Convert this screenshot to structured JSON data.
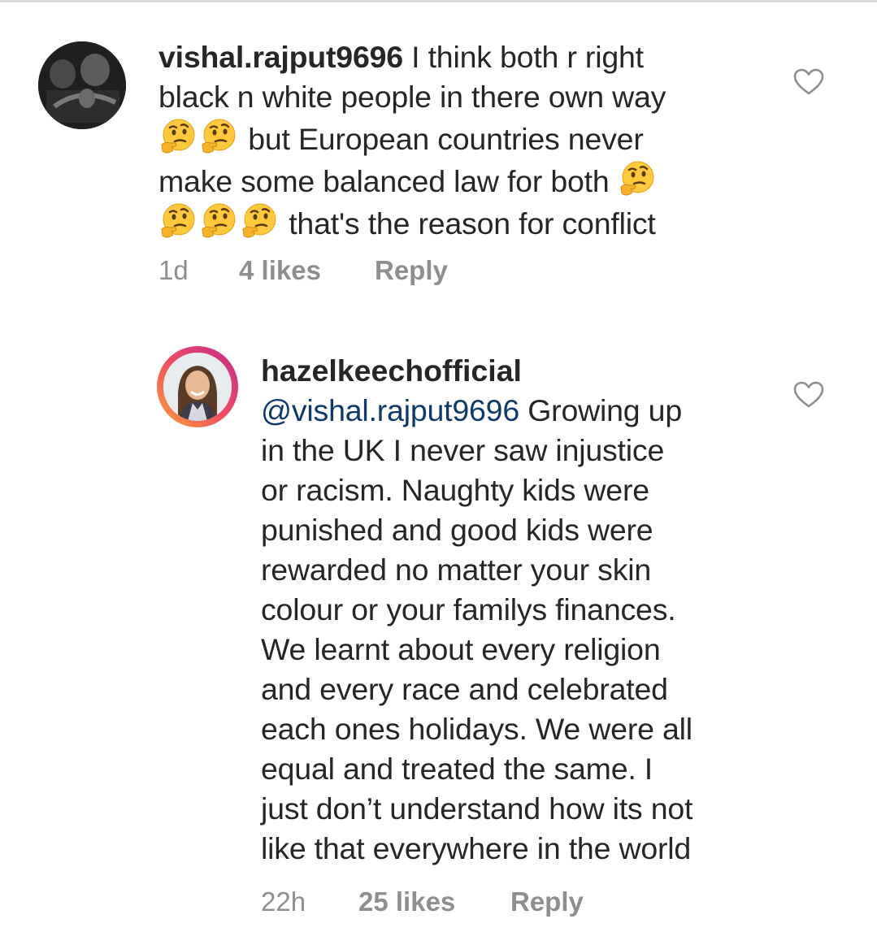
{
  "comments": [
    {
      "username": "vishal.rajput9696",
      "lines": [
        "I think both r right",
        "black n white people in there own way",
        " but European countries never",
        "make some balanced law for both ",
        " that's the reason for conflict"
      ],
      "emoji": "thinking-face",
      "time": "1d",
      "likes": "4 likes",
      "reply": "Reply"
    },
    {
      "username": "hazelkeechofficial",
      "mention": "@vishal.rajput9696",
      "lines": [
        "Growing up",
        "in the UK I never saw injustice",
        "or racism. Naughty kids were",
        "punished and good kids were",
        "rewarded no matter your skin",
        "colour or your familys finances.",
        "We learnt about every religion",
        "and every race and celebrated",
        "each ones holidays. We were all",
        "equal and treated the same. I",
        "just don’t understand how its not",
        "like that everywhere in the world"
      ],
      "time": "22h",
      "likes": "25 likes",
      "reply": "Reply"
    }
  ],
  "icons": {
    "like": "heart-outline-icon",
    "emoji": "thinking-face-emoji"
  },
  "colors": {
    "text": "#262626",
    "meta": "#8e8e8e",
    "mention": "#0e3a6b",
    "story_ring_start": "#f9a33a",
    "story_ring_end": "#c22b91"
  }
}
